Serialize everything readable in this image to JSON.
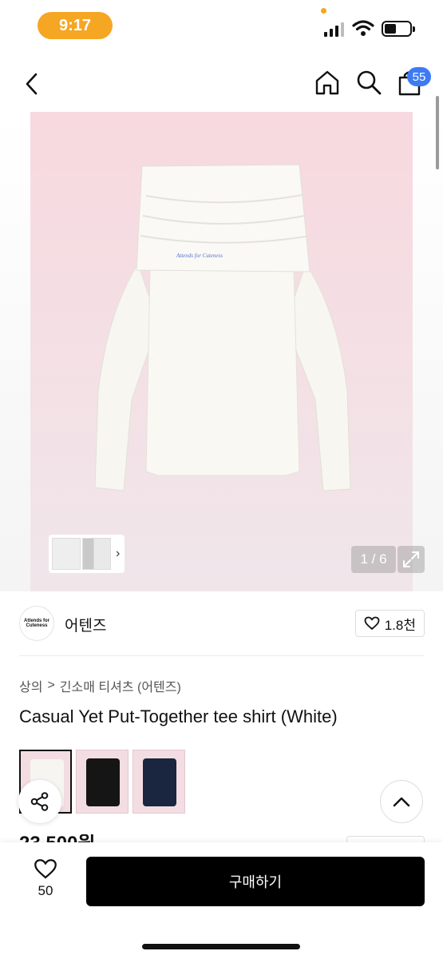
{
  "status_bar": {
    "time": "9:17",
    "battery_level": 0.45
  },
  "header": {
    "back_icon": "chevron-left-icon",
    "home_icon": "home-icon",
    "search_icon": "search-icon",
    "bag_icon": "shopping-bag-icon",
    "bag_count": "55"
  },
  "gallery": {
    "page_counter": "1 / 6",
    "thumb_arrow": "›",
    "garment_logo_text": "Attends for Cuteness"
  },
  "brand": {
    "logo_text_line1": "Attends for",
    "logo_text_line2": "Cuteness",
    "name": "어텐즈",
    "like_count": "1.8천"
  },
  "breadcrumb": {
    "level1": "상의",
    "separator": ">",
    "level2": "긴소매 티셔츠 (어텐즈)"
  },
  "product": {
    "title": "Casual Yet Put-Together tee shirt (White)",
    "price_partial": "23,500원",
    "color_options": [
      "white",
      "black",
      "navy"
    ],
    "selected_color": "white"
  },
  "bottom_bar": {
    "wish_count": "50",
    "buy_label": "구매하기"
  },
  "colors": {
    "accent_orange": "#f5a623",
    "badge_blue": "#3d7bf5",
    "image_bg_pink": "#f7d9df",
    "buy_button": "#000000"
  }
}
